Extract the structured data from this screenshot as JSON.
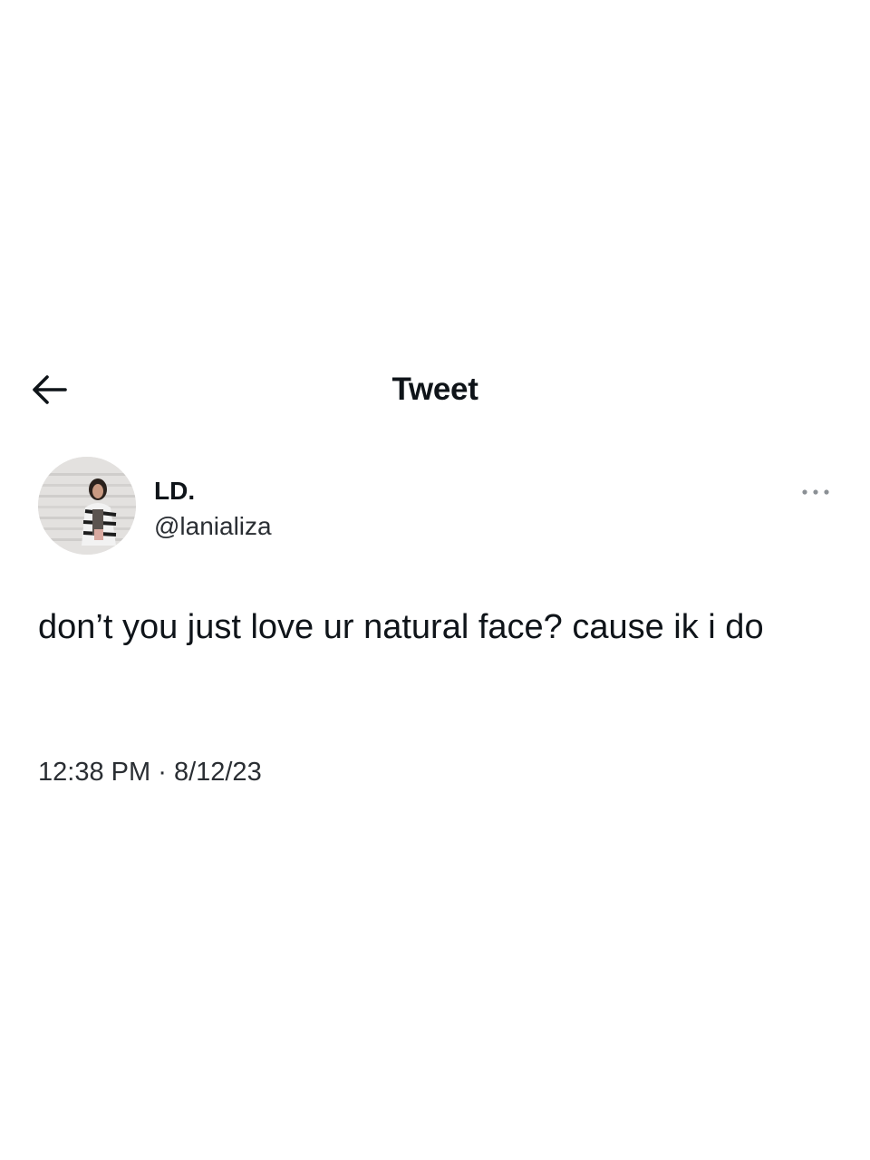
{
  "header": {
    "back_icon": "arrow-left-icon",
    "title": "Tweet"
  },
  "author": {
    "display_name": "LD.",
    "handle": "@lanializa",
    "avatar_icon": "profile-photo",
    "more_icon": "more-horizontal-icon"
  },
  "tweet": {
    "text": "don’t you just love ur natural face? cause ik i do",
    "time": "12:38 PM",
    "separator": "·",
    "date": "8/12/23"
  }
}
